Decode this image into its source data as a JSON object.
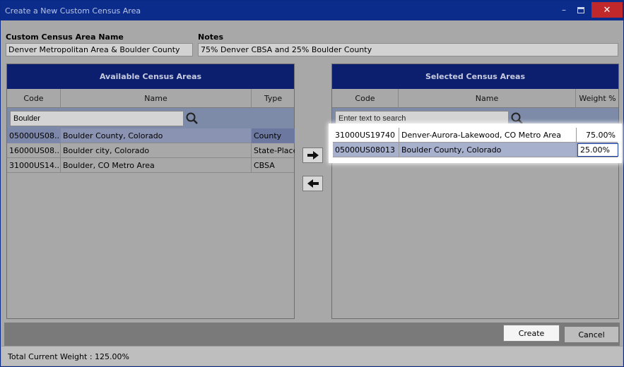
{
  "window": {
    "title": "Create a New Custom Census Area",
    "minimize_glyph": "–",
    "close_glyph": "✕"
  },
  "form": {
    "name_label": "Custom Census Area Name",
    "name_value": "Denver Metropolitan Area & Boulder County",
    "notes_label": "Notes",
    "notes_value": "75% Denver CBSA and 25% Boulder County"
  },
  "available": {
    "header": "Available Census Areas",
    "columns": {
      "code": "Code",
      "name": "Name",
      "type": "Type"
    },
    "search_value": "Boulder",
    "rows": [
      {
        "code": "05000US08...",
        "name": "Boulder County, Colorado",
        "type": "County",
        "selected": true
      },
      {
        "code": "16000US08...",
        "name": "Boulder city, Colorado",
        "type": "State-Place",
        "selected": false
      },
      {
        "code": "31000US14...",
        "name": "Boulder, CO Metro Area",
        "type": "CBSA",
        "selected": false
      }
    ]
  },
  "selected": {
    "header": "Selected Census Areas",
    "columns": {
      "code": "Code",
      "name": "Name",
      "weight": "Weight %"
    },
    "search_placeholder": "Enter text to search",
    "rows": [
      {
        "code": "31000US19740",
        "name": "Denver-Aurora-Lakewood, CO Metro Area",
        "weight": "75.00%"
      },
      {
        "code": "05000US08013",
        "name": "Boulder County, Colorado",
        "weight": "25.00%"
      }
    ]
  },
  "buttons": {
    "add_icon": "arrow-right-icon",
    "remove_icon": "arrow-left-icon",
    "create": "Create",
    "cancel": "Cancel"
  },
  "status": {
    "text": "Total Current Weight : 125.00%"
  }
}
